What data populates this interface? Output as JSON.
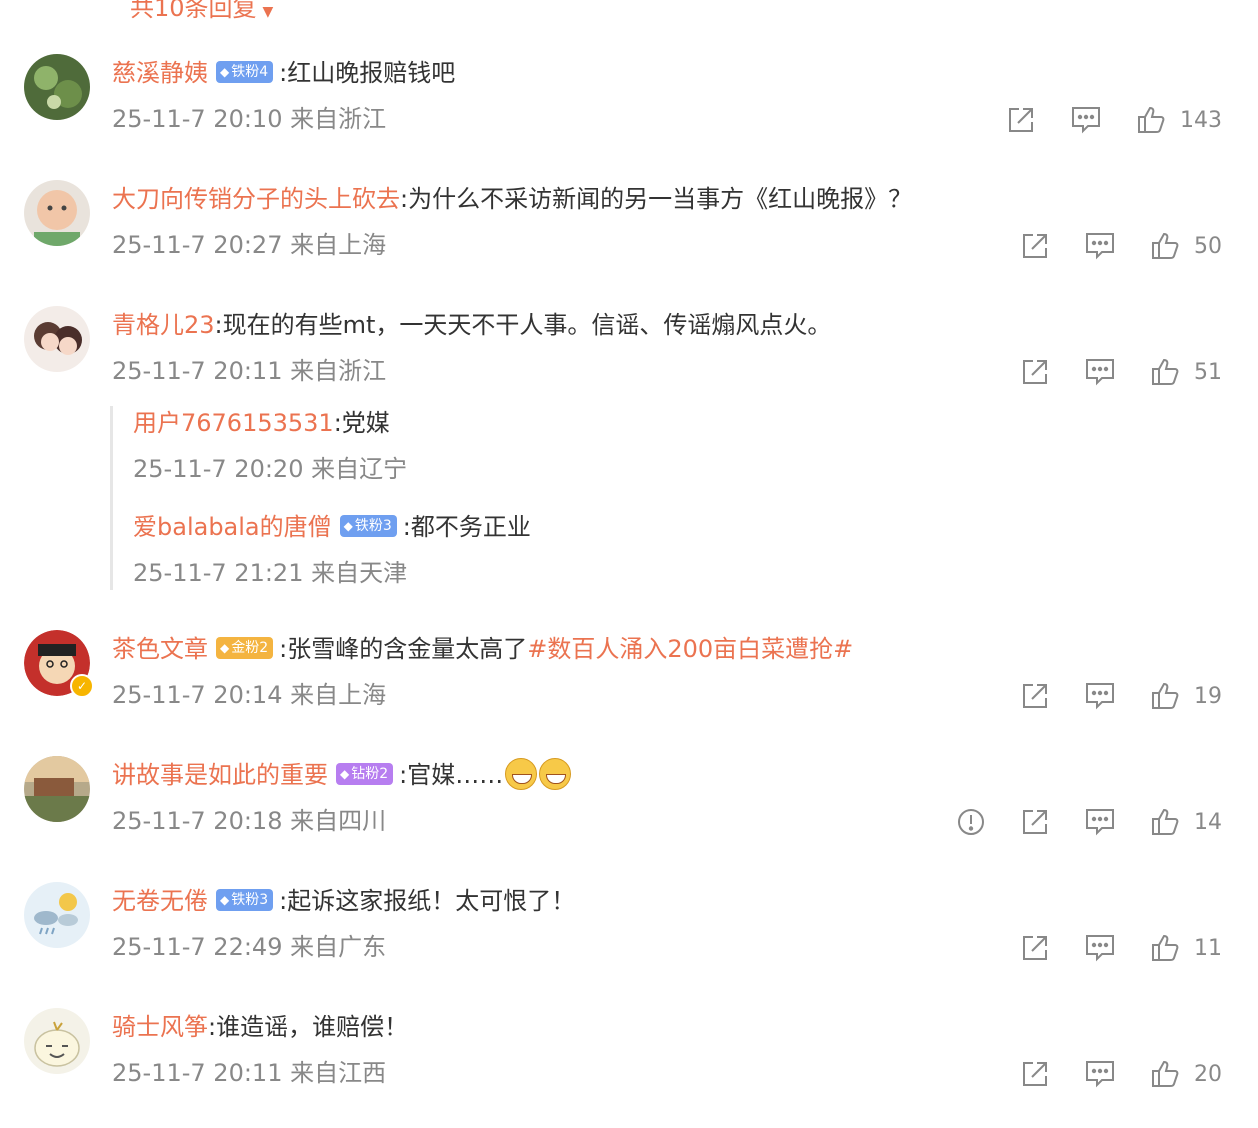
{
  "top_reply_link": "共10条回复",
  "comments": [
    {
      "username": "慈溪静姨",
      "badge": {
        "label": "铁粉4",
        "color": "#6f9ff0"
      },
      "content": "红山晚报赔钱吧",
      "time": "25-11-7 20:10",
      "location": "来自浙江",
      "likes": "143"
    },
    {
      "username": "大刀向传销分子的头上砍去",
      "content": "为什么不采访新闻的另一当事方《红山晚报》？",
      "time": "25-11-7 20:27",
      "location": "来自上海",
      "likes": "50"
    },
    {
      "username": "青格儿23",
      "content": "现在的有些mt，一天天不干人事。信谣、传谣煽风点火。",
      "time": "25-11-7 20:11",
      "location": "来自浙江",
      "likes": "51"
    },
    {
      "username": "茶色文章",
      "badge": {
        "label": "金粉2",
        "color": "#f4b440"
      },
      "content": "张雪峰的含金量太高了",
      "hashtag": "#数百人涌入200亩白菜遭抢#",
      "time": "25-11-7 20:14",
      "location": "来自上海",
      "likes": "19"
    },
    {
      "username": "讲故事是如此的重要",
      "badge": {
        "label": "钻粉2",
        "color": "#b77ef0"
      },
      "content": "官媒……",
      "time": "25-11-7 20:18",
      "location": "来自四川",
      "likes": "14"
    },
    {
      "username": "无卷无倦",
      "badge": {
        "label": "铁粉3",
        "color": "#6f9ff0"
      },
      "content": "起诉这家报纸！太可恨了！",
      "time": "25-11-7 22:49",
      "location": "来自广东",
      "likes": "11"
    },
    {
      "username": "骑士风筝",
      "content": "谁造谣，谁赔偿！",
      "time": "25-11-7 20:11",
      "location": "来自江西",
      "likes": "20"
    }
  ],
  "sub_replies": [
    {
      "username": "用户7676153531",
      "content": "党媒",
      "time": "25-11-7 20:20",
      "location": "来自辽宁"
    },
    {
      "username": "爱balabala的唐僧",
      "badge": {
        "label": "铁粉3",
        "color": "#6f9ff0"
      },
      "content": "都不务正业",
      "time": "25-11-7 21:21",
      "location": "来自天津"
    }
  ],
  "icons": {
    "share": "share-icon",
    "comment": "comment-icon",
    "like": "thumbs-up-icon",
    "report": "report-icon",
    "verified": "verified-badge-icon",
    "emoji": "grin-emoji-icon"
  }
}
